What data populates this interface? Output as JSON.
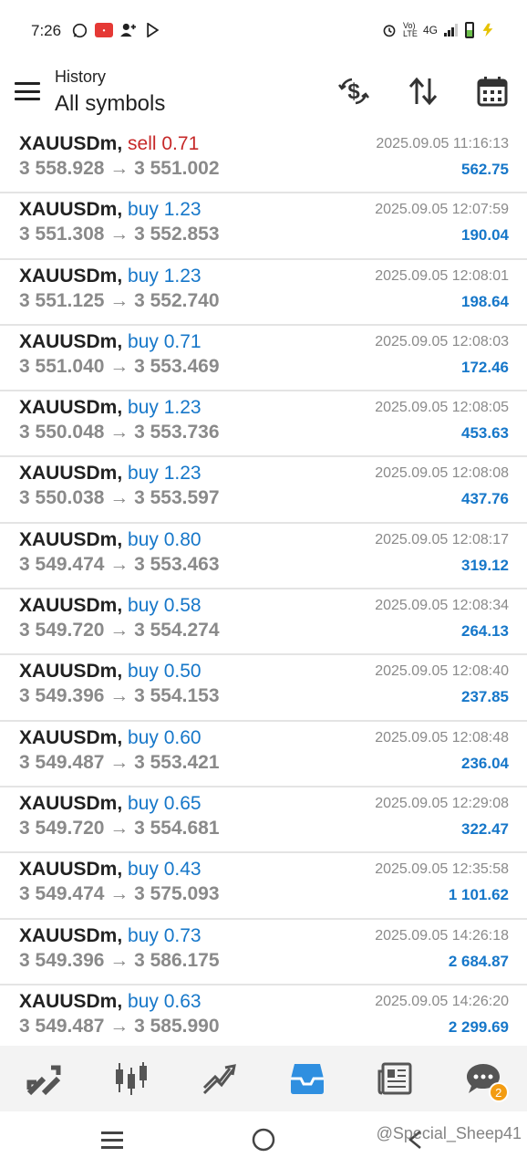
{
  "status_bar": {
    "time": "7:26",
    "network": "4G",
    "lte": "Vo) LTE"
  },
  "header": {
    "subtitle": "History",
    "title": "All symbols"
  },
  "trades": [
    {
      "symbol": "XAUUSDm,",
      "side": "sell",
      "volume": "0.71",
      "prices": "3 558.928 → 3 551.002",
      "time": "2025.09.05 11:16:13",
      "profit": "562.75"
    },
    {
      "symbol": "XAUUSDm,",
      "side": "buy",
      "volume": "1.23",
      "prices": "3 551.308 → 3 552.853",
      "time": "2025.09.05 12:07:59",
      "profit": "190.04"
    },
    {
      "symbol": "XAUUSDm,",
      "side": "buy",
      "volume": "1.23",
      "prices": "3 551.125 → 3 552.740",
      "time": "2025.09.05 12:08:01",
      "profit": "198.64"
    },
    {
      "symbol": "XAUUSDm,",
      "side": "buy",
      "volume": "0.71",
      "prices": "3 551.040 → 3 553.469",
      "time": "2025.09.05 12:08:03",
      "profit": "172.46"
    },
    {
      "symbol": "XAUUSDm,",
      "side": "buy",
      "volume": "1.23",
      "prices": "3 550.048 → 3 553.736",
      "time": "2025.09.05 12:08:05",
      "profit": "453.63"
    },
    {
      "symbol": "XAUUSDm,",
      "side": "buy",
      "volume": "1.23",
      "prices": "3 550.038 → 3 553.597",
      "time": "2025.09.05 12:08:08",
      "profit": "437.76"
    },
    {
      "symbol": "XAUUSDm,",
      "side": "buy",
      "volume": "0.80",
      "prices": "3 549.474 → 3 553.463",
      "time": "2025.09.05 12:08:17",
      "profit": "319.12"
    },
    {
      "symbol": "XAUUSDm,",
      "side": "buy",
      "volume": "0.58",
      "prices": "3 549.720 → 3 554.274",
      "time": "2025.09.05 12:08:34",
      "profit": "264.13"
    },
    {
      "symbol": "XAUUSDm,",
      "side": "buy",
      "volume": "0.50",
      "prices": "3 549.396 → 3 554.153",
      "time": "2025.09.05 12:08:40",
      "profit": "237.85"
    },
    {
      "symbol": "XAUUSDm,",
      "side": "buy",
      "volume": "0.60",
      "prices": "3 549.487 → 3 553.421",
      "time": "2025.09.05 12:08:48",
      "profit": "236.04"
    },
    {
      "symbol": "XAUUSDm,",
      "side": "buy",
      "volume": "0.65",
      "prices": "3 549.720 → 3 554.681",
      "time": "2025.09.05 12:29:08",
      "profit": "322.47"
    },
    {
      "symbol": "XAUUSDm,",
      "side": "buy",
      "volume": "0.43",
      "prices": "3 549.474 → 3 575.093",
      "time": "2025.09.05 12:35:58",
      "profit": "1 101.62"
    },
    {
      "symbol": "XAUUSDm,",
      "side": "buy",
      "volume": "0.73",
      "prices": "3 549.396 → 3 586.175",
      "time": "2025.09.05 14:26:18",
      "profit": "2 684.87"
    },
    {
      "symbol": "XAUUSDm,",
      "side": "buy",
      "volume": "0.63",
      "prices": "3 549.487 → 3 585.990",
      "time": "2025.09.05 14:26:20",
      "profit": "2 299.69"
    }
  ],
  "bottom_nav": {
    "items": [
      "quotes-icon",
      "chart-icon",
      "trade-icon",
      "history-icon",
      "news-icon",
      "messages-icon"
    ],
    "active": "history-icon",
    "messages_badge": "2"
  },
  "watermark": "@Special_Sheep41",
  "colors": {
    "buy": "#1677c9",
    "sell": "#c62828",
    "accent": "#2f8fe0"
  }
}
